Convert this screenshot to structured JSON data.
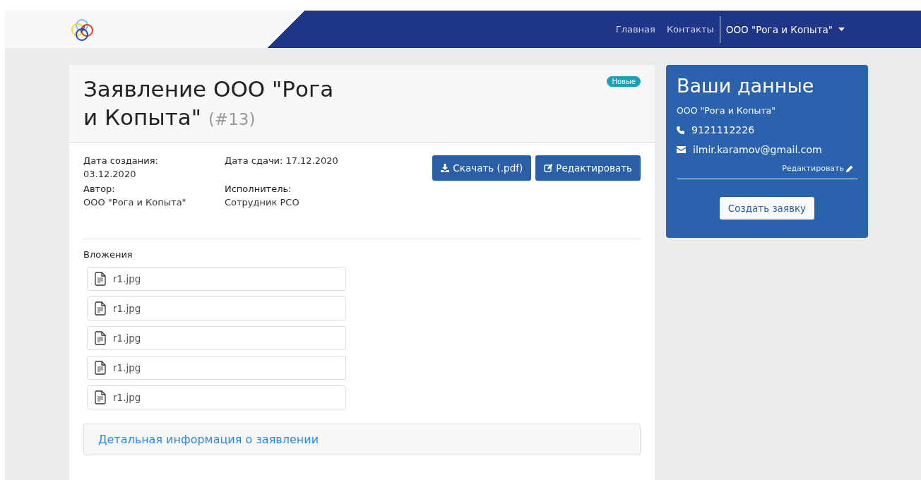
{
  "navbar": {
    "links": [
      "Главная",
      "Контакты"
    ],
    "account": "ООО \"Рога и Копыта\""
  },
  "application": {
    "title": "Заявление ООО \"Рога и Копыта\"",
    "number": "(#13)",
    "status": "Новые",
    "fields": [
      {
        "label": "Дата создания:",
        "value": "03.12.2020",
        "inline": false
      },
      {
        "label": "Дата сдачи:",
        "value": "17.12.2020",
        "inline": true
      },
      {
        "label": "Автор:",
        "value": "ООО \"Рога и Копыта\"",
        "inline": false
      },
      {
        "label": "Исполнитель:",
        "value": "Сотрудник РСО",
        "inline": false
      }
    ],
    "buttons": [
      {
        "kind": "download",
        "label": "Скачать (.pdf)"
      },
      {
        "kind": "edit",
        "label": "Редактировать"
      }
    ],
    "attachments_title": "Вложения",
    "attachments": [
      "r1.jpg",
      "r1.jpg",
      "r1.jpg",
      "r1.jpg",
      "r1.jpg"
    ],
    "details_link": "Детальная информация о заявлении"
  },
  "profile": {
    "title": "Ваши данные",
    "company": "ООО \"Рога и Копыта\"",
    "phone": "9121112226",
    "email": "ilmir.karamov@gmail.com",
    "edit_link": "Редактировать",
    "create_button": "Создать заявку"
  }
}
